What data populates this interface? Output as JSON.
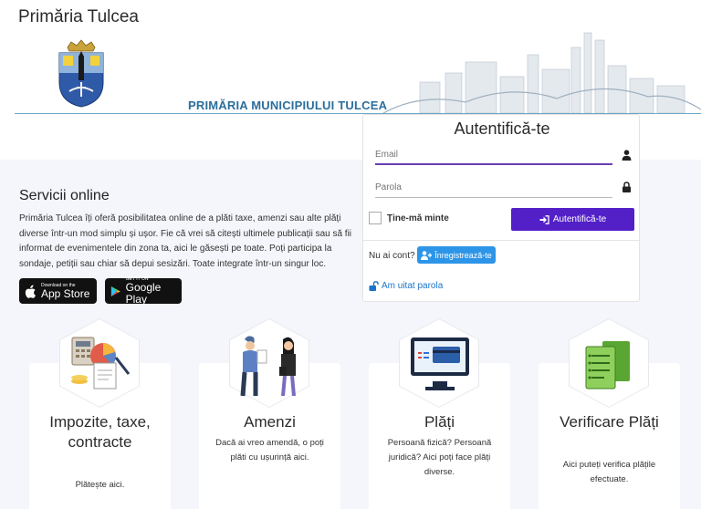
{
  "header": {
    "site_title": "Primăria Tulcea",
    "banner_text": "PRIMĂRIA MUNICIPIULUI TULCEA"
  },
  "services": {
    "title": "Servicii online",
    "description": "Primăria Tulcea îți oferă posibilitatea online de a plăti taxe, amenzi sau alte plăți diverse într-un mod simplu și ușor. Fie că vrei să citești ultimele publicații sau să fii informat de evenimentele din zona ta, aici le găsești pe toate. Poți participa la sondaje, petiții sau chiar să depui sesizări. Toate integrate într-un singur loc."
  },
  "stores": {
    "appstore_small": "Download on the",
    "appstore_big": "App Store",
    "googleplay_small": "GET IT ON",
    "googleplay_big": "Google Play"
  },
  "login": {
    "title": "Autentifică-te",
    "email_placeholder": "Email",
    "password_placeholder": "Parola",
    "remember_label": "Ține-mă minte",
    "submit_label": "Autentifică-te",
    "no_account_text": "Nu ai cont?",
    "register_label": "Înregistrează-te",
    "forgot_label": "Am uitat parola"
  },
  "cards": [
    {
      "title": "Impozite, taxe, contracte",
      "description": "Plătește aici."
    },
    {
      "title": "Amenzi",
      "description": "Dacă ai vreo amendă, o poți plăti cu ușurință aici."
    },
    {
      "title": "Plăți",
      "description": "Persoană fizică? Persoană juridică? Aici poți face plăți diverse."
    },
    {
      "title": "Verificare Plăți",
      "description": "Aici puteți verifica plățile efectuate."
    }
  ],
  "colors": {
    "login_button": "#5320c8",
    "register_button": "#2d95e8",
    "banner_text": "#2a6f9c",
    "link": "#1a73c8"
  },
  "icons": [
    "user-icon",
    "lock-icon",
    "sign-in-icon",
    "user-plus-icon",
    "unlock-icon",
    "apple-icon",
    "google-play-icon"
  ]
}
